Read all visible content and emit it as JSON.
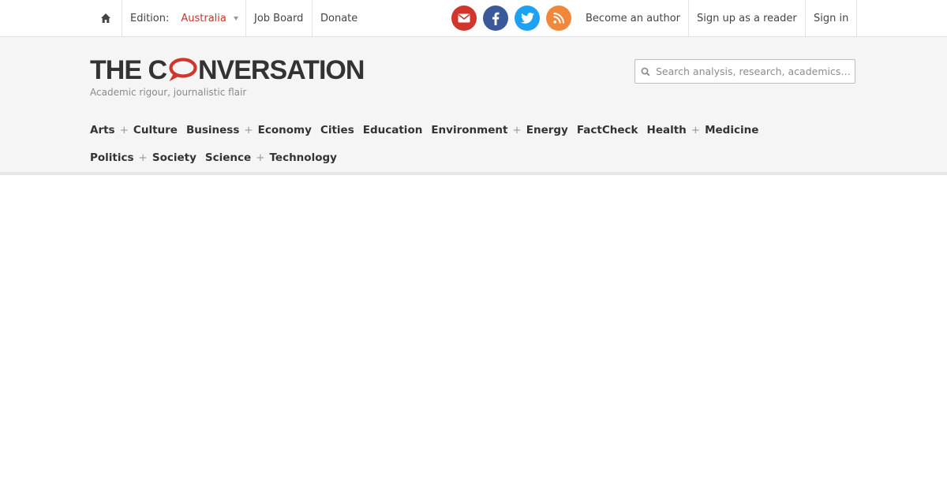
{
  "topbar": {
    "edition_label": "Edition:",
    "edition_value": "Australia",
    "job_board": "Job Board",
    "donate": "Donate",
    "social": [
      "email-icon",
      "facebook-icon",
      "twitter-icon",
      "rss-icon"
    ],
    "become_author": "Become an author",
    "sign_up": "Sign up as a reader",
    "sign_in": "Sign in"
  },
  "header": {
    "logo_before": "THE C",
    "logo_after": "NVERSATION",
    "tagline": "Academic rigour, journalistic flair",
    "search_placeholder": "Search analysis, research, academics…"
  },
  "nav": [
    {
      "a": "Arts",
      "b": "Culture"
    },
    {
      "a": "Business",
      "b": "Economy"
    },
    {
      "a": "Cities"
    },
    {
      "a": "Education"
    },
    {
      "a": "Environment",
      "b": "Energy"
    },
    {
      "a": "FactCheck"
    },
    {
      "a": "Health",
      "b": "Medicine"
    },
    {
      "a": "Politics",
      "b": "Society"
    },
    {
      "a": "Science",
      "b": "Technology"
    }
  ],
  "colors": {
    "accent": "#c0392b",
    "email": "#d1352b",
    "facebook": "#3b5998",
    "twitter": "#1da1f2",
    "rss": "#f0883c"
  }
}
